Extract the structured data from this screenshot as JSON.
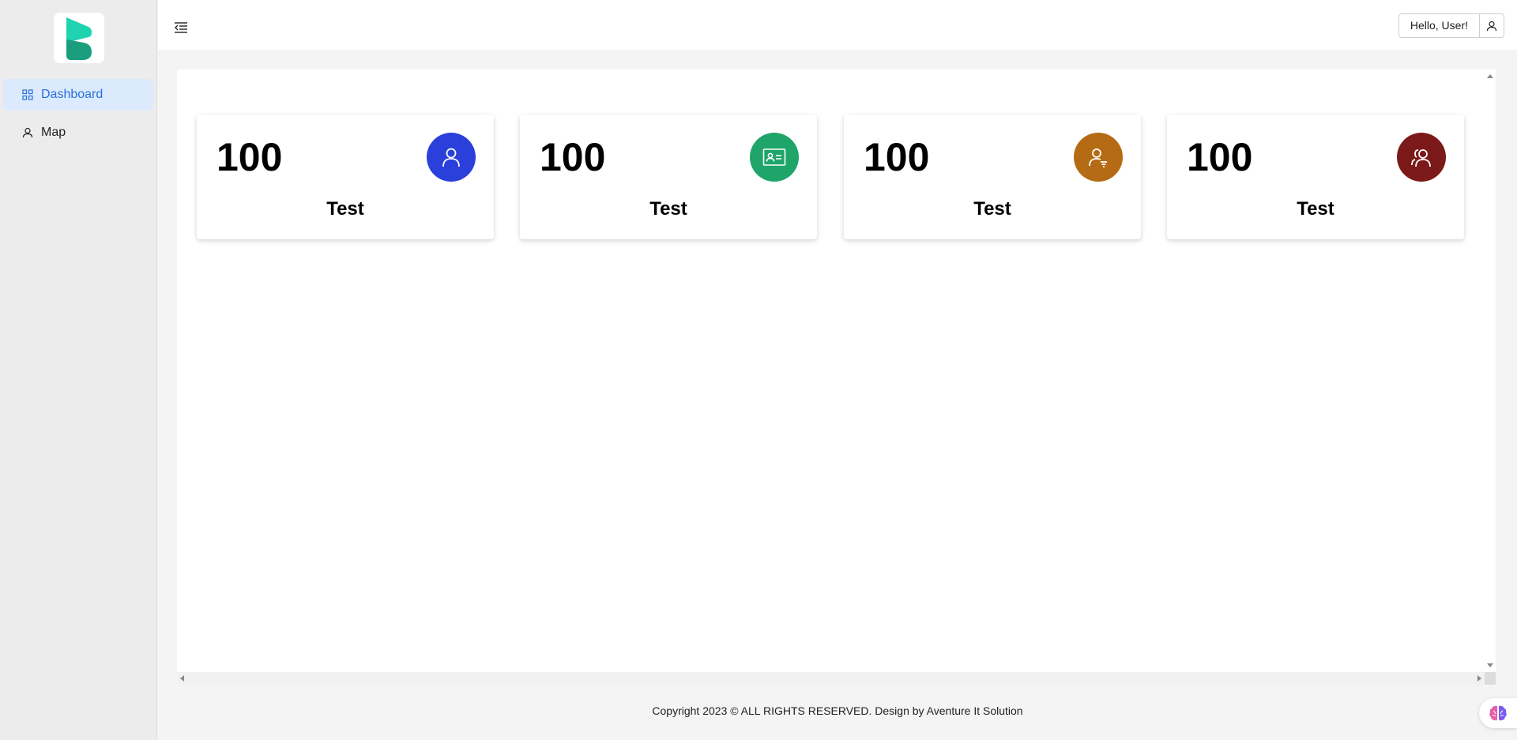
{
  "sidebar": {
    "logo": "brand-logo",
    "items": [
      {
        "label": "Dashboard",
        "icon": "grid-icon",
        "active": true
      },
      {
        "label": "Map",
        "icon": "user-icon",
        "active": false
      }
    ]
  },
  "header": {
    "menu_icon": "menu-collapse-icon",
    "greeting": "Hello, User!",
    "user_icon": "user-icon"
  },
  "cards": [
    {
      "value": "100",
      "label": "Test",
      "icon": "user-icon",
      "color": "#2b3fdb"
    },
    {
      "value": "100",
      "label": "Test",
      "icon": "id-card-icon",
      "color": "#1fa56a"
    },
    {
      "value": "100",
      "label": "Test",
      "icon": "user-filter-icon",
      "color": "#b56a14"
    },
    {
      "value": "100",
      "label": "Test",
      "icon": "users-icon",
      "color": "#7c1a1a"
    }
  ],
  "footer": {
    "text": "Copyright 2023 © ALL RIGHTS RESERVED. Design by Aventure It Solution"
  },
  "colors": {
    "accent": "#2a6fdb",
    "active_bg": "#dbeafc",
    "brand_teal": "#1ec8a5"
  }
}
